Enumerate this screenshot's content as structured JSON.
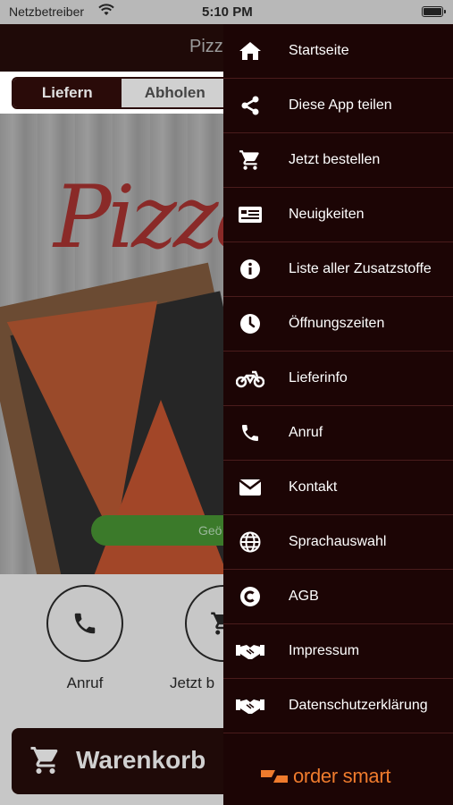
{
  "status_bar": {
    "carrier": "Netzbetreiber",
    "time": "5:10 PM"
  },
  "header": {
    "title": "Pizz"
  },
  "delivery_toggle": {
    "options": [
      "Liefern",
      "Abholen"
    ],
    "selected": "Liefern"
  },
  "hero": {
    "logo_text": "Pizza",
    "open_button_label": "Geö"
  },
  "actions": [
    {
      "label": "Anruf",
      "icon": "phone-icon"
    },
    {
      "label": "Jetzt b",
      "icon": "cart-icon"
    }
  ],
  "cart": {
    "label": "Warenkorb"
  },
  "menu": {
    "items": [
      {
        "label": "Startseite",
        "icon": "home-icon"
      },
      {
        "label": "Diese App teilen",
        "icon": "share-icon"
      },
      {
        "label": "Jetzt bestellen",
        "icon": "cart-icon"
      },
      {
        "label": "Neuigkeiten",
        "icon": "newspaper-icon"
      },
      {
        "label": "Liste aller Zusatzstoffe",
        "icon": "info-icon"
      },
      {
        "label": "Öffnungszeiten",
        "icon": "clock-icon"
      },
      {
        "label": "Lieferinfo",
        "icon": "motorcycle-icon"
      },
      {
        "label": "Anruf",
        "icon": "phone-icon"
      },
      {
        "label": "Kontakt",
        "icon": "envelope-icon"
      },
      {
        "label": "Sprachauswahl",
        "icon": "globe-icon"
      },
      {
        "label": "AGB",
        "icon": "copyright-icon"
      },
      {
        "label": "Impressum",
        "icon": "handshake-icon"
      },
      {
        "label": "Datenschutzerklärung",
        "icon": "handshake-icon"
      }
    ]
  },
  "brand": {
    "name": "order smart"
  },
  "colors": {
    "drawer_bg": "#1c0505",
    "header_bg": "#1f0a08",
    "brand_orange": "#ef7b2d",
    "open_green": "#3b7a2a"
  }
}
